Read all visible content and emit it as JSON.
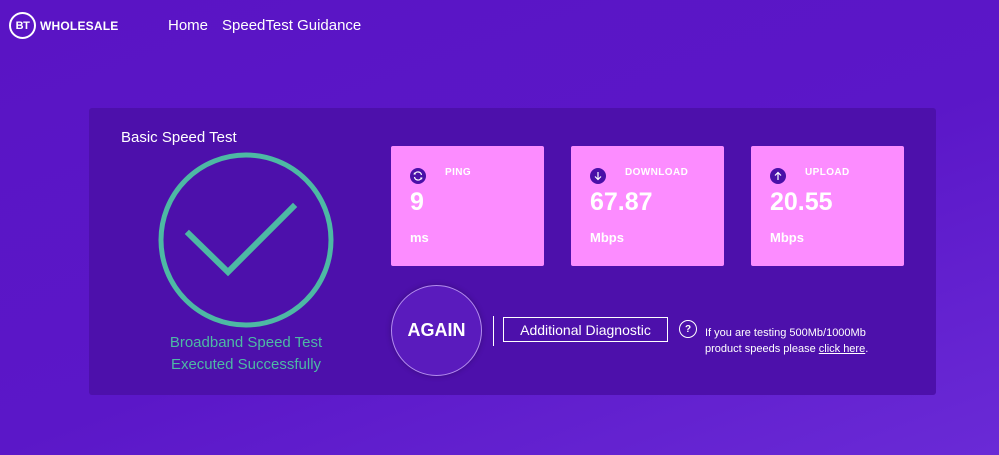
{
  "header": {
    "logo_mark": "BT",
    "logo_text": "WHOLESALE",
    "nav": [
      {
        "label": "Home"
      },
      {
        "label": "SpeedTest Guidance"
      }
    ]
  },
  "panel": {
    "title": "Basic Speed Test",
    "success_line1": "Broadband Speed Test",
    "success_line2": "Executed Successfully",
    "success_color": "#4db9a4"
  },
  "cards": {
    "ping": {
      "label": "PING",
      "value": "9",
      "unit": "ms",
      "icon": "refresh-icon"
    },
    "download": {
      "label": "DOWNLOAD",
      "value": "67.87",
      "unit": "Mbps",
      "icon": "arrow-down-icon"
    },
    "upload": {
      "label": "UPLOAD",
      "value": "20.55",
      "unit": "Mbps",
      "icon": "arrow-up-icon"
    },
    "card_color": "#fc8cff"
  },
  "actions": {
    "again_label": "AGAIN",
    "diagnostic_label": "Additional Diagnostic",
    "help_symbol": "?",
    "note_text": "If you are testing 500Mb/1000Mb product speeds please ",
    "note_link": "click here",
    "note_end": "."
  },
  "colors": {
    "background": "#5a14c4",
    "panel": "#4d10ab",
    "icon_bg": "#4a10a8"
  }
}
